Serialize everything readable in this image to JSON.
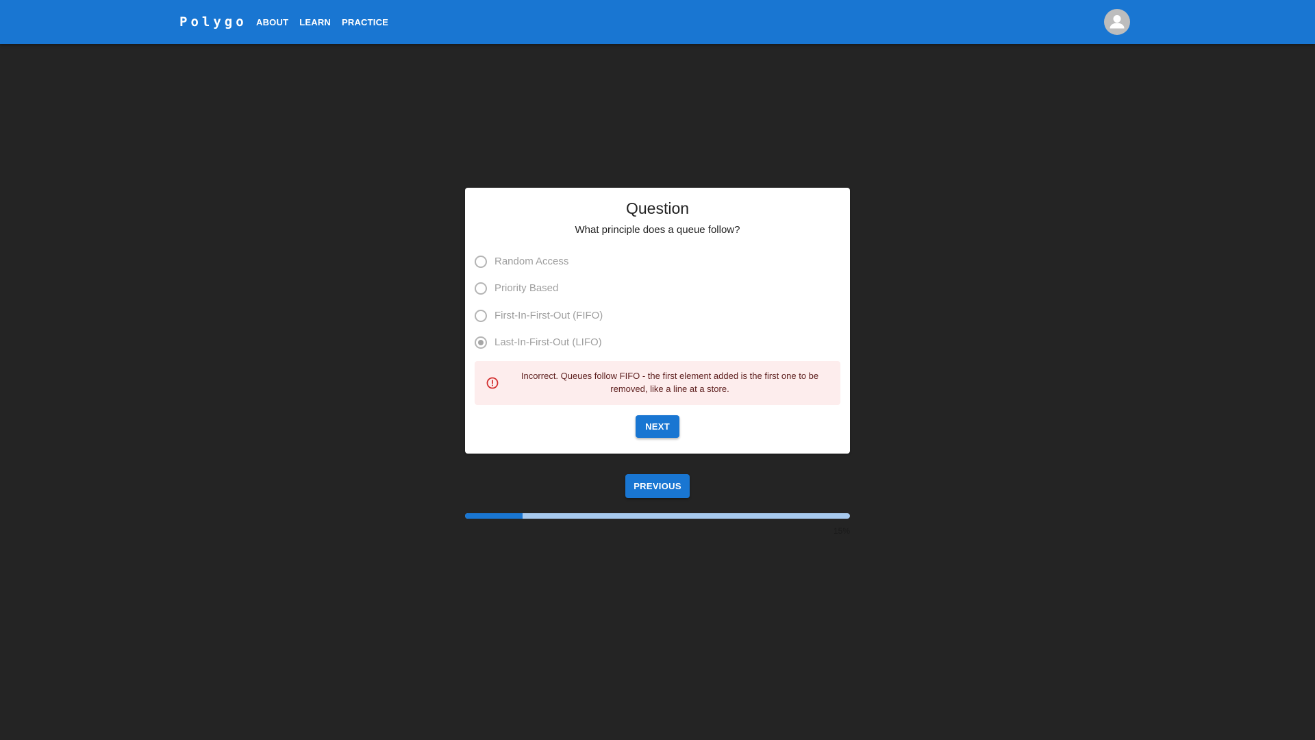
{
  "app": {
    "logo": "Polygo",
    "nav": [
      "ABOUT",
      "LEARN",
      "PRACTICE"
    ]
  },
  "quiz": {
    "title": "Question",
    "question": "What principle does a queue follow?",
    "options": [
      {
        "label": "Random Access",
        "checked": false
      },
      {
        "label": "Priority Based",
        "checked": false
      },
      {
        "label": "First-In-First-Out (FIFO)",
        "checked": false
      },
      {
        "label": "Last-In-First-Out (LIFO)",
        "checked": true
      }
    ],
    "feedback": "Incorrect. Queues follow FIFO - the first element added is the first one to be removed, like a line at a store.",
    "next_label": "NEXT",
    "previous_label": "PREVIOUS"
  },
  "progress": {
    "percent": 15,
    "text": "15%"
  },
  "colors": {
    "primary": "#1976d2",
    "background": "#242424",
    "error": "#d32f2f",
    "error_bg": "#fdeded"
  },
  "icons": {
    "user": "account-circle-icon",
    "alert": "error-outline-icon"
  }
}
